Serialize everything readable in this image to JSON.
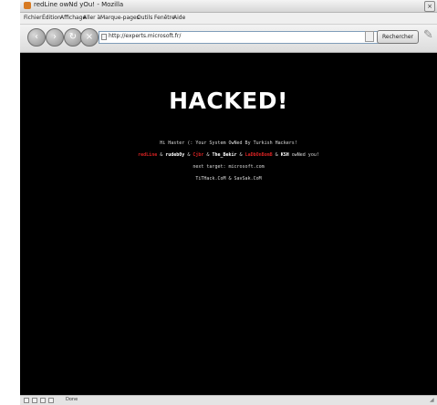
{
  "window": {
    "title": "redLine owNd yOu! - Mozilla",
    "close_glyph": "×"
  },
  "menu": {
    "items": [
      "Fichier",
      "Édition",
      "Affichage",
      "Aller à",
      "Marque-pages",
      "Outils",
      "Fenêtre",
      "Aide"
    ]
  },
  "nav": {
    "back_glyph": "‹",
    "forward_glyph": "›",
    "reload_glyph": "↻",
    "stop_glyph": "×",
    "url": "http://experts.microsoft.fr/",
    "search_label": "Rechercher"
  },
  "page": {
    "headline": "HACKED!",
    "line1": "Hi Haster (: Your System OwNed By Turkish Hackers!",
    "credits": [
      {
        "text": "redLine",
        "style": "red"
      },
      {
        "text": " & ",
        "style": "plain"
      },
      {
        "text": "rudeb0y",
        "style": "wht"
      },
      {
        "text": " & ",
        "style": "plain"
      },
      {
        "text": "Cjbr",
        "style": "red"
      },
      {
        "text": " & ",
        "style": "plain"
      },
      {
        "text": "The_Bekir",
        "style": "wht"
      },
      {
        "text": " & ",
        "style": "plain"
      },
      {
        "text": "LaDbOnBomB",
        "style": "red"
      },
      {
        "text": " & ",
        "style": "plain"
      },
      {
        "text": "KSH",
        "style": "wht"
      },
      {
        "text": " owNed you!",
        "style": "plain"
      }
    ],
    "line3": "next target: microsoft.com",
    "line4": "TiTHack.CoM & SavSak.CoM"
  },
  "status": {
    "text": "Done"
  },
  "colors": {
    "page_background": "#000000",
    "headline": "#ffffff",
    "accent_red": "#d42222"
  }
}
